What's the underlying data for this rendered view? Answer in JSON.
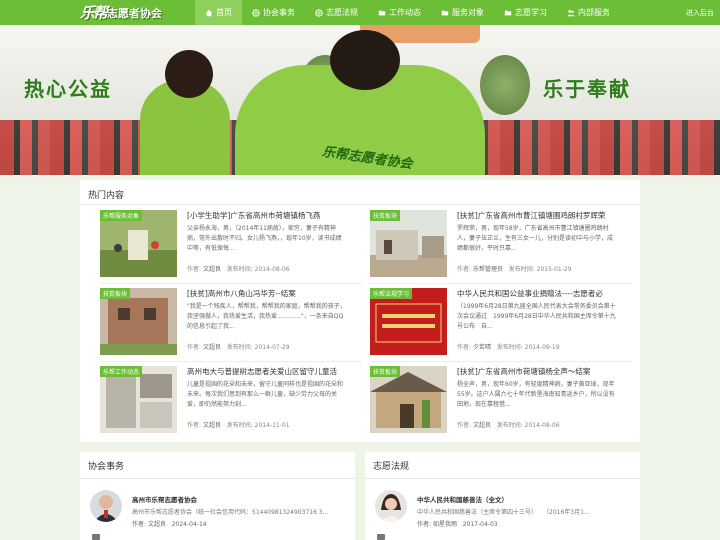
{
  "site": {
    "logo_big": "乐帮",
    "logo_small": "志愿者协会",
    "login": "进入后台"
  },
  "menu": [
    {
      "label": "首页",
      "icon": "home-icon",
      "active": true
    },
    {
      "label": "协会事务",
      "icon": "globe-icon"
    },
    {
      "label": "志愿法规",
      "icon": "globe-icon"
    },
    {
      "label": "工作动态",
      "icon": "folder-icon"
    },
    {
      "label": "服务对象",
      "icon": "folder-icon"
    },
    {
      "label": "志愿学习",
      "icon": "folder-icon"
    },
    {
      "label": "内部服务",
      "icon": "users-icon"
    }
  ],
  "banner": {
    "slogan_left": "热心公益",
    "slogan_right": "乐于奉献",
    "jacket_text": "乐帮志愿者协会"
  },
  "hot": {
    "title": "热门内容",
    "items": [
      {
        "tag": "乐帮服务对象",
        "title": "[小学生助学]广东省高州市荷塘镇杨飞燕",
        "desc": "父亲杨永海，男，（2014年11病故），家穷，妻子有精神病，常外出散时不归。女儿杨飞燕，，现年10岁，读书成绩中等，有低保每...",
        "author_label": "作者:",
        "author": "文超良",
        "date_label": "发布时间:",
        "date": "2014-08-06"
      },
      {
        "tag": "扶贫板块",
        "title": "[扶贫]广东省高州市曹江镇塘圃鸡朗村罗辉荣",
        "desc": "罗辉荣，男，现年58岁，广东省高州市曹江镇塘圃鸡朗村人，妻子伍正兰，生有三女一儿，分别是读初中与小学，成绩都很好，平时只靠...",
        "author_label": "作者:",
        "author": "乐帮管理员",
        "date_label": "发布时间:",
        "date": "2015-01-29"
      },
      {
        "tag": "扶贫板块",
        "title": "[扶贫]高州市八角山冯华芳--结案",
        "desc": "\"我是一个残疾人，帮帮我，帮帮我的家庭，帮帮我的孩子，我坚强做人，我热爱生活，我热爱…………\"，一条来自QQ的信息引起了我...",
        "author_label": "作者:",
        "author": "文超良",
        "date_label": "发布时间:",
        "date": "2014-07-29"
      },
      {
        "tag": "乐帮法规学习",
        "title": "中华人民共和国公益事业捐赠法----志愿者必",
        "desc": "（1999年6月28日第九届全国人民代表大会常务委员会第十次会议通过　1999年6月28日中华人民共和国主席令第十九号公布　自...",
        "author_label": "作者:",
        "author": "夕若晴",
        "date_label": "发布时间:",
        "date": "2014-09-19"
      },
      {
        "tag": "乐帮工作动态",
        "title": "高州电大与普提树志愿者关爱山区留守儿童活",
        "desc": "儿童是祖国的花朵和未来，留守儿童同样也是祖国的花朵和未来。每次我们思到有那么一群儿童，缺少劳力父母的关爱，即仍然能努力刻...",
        "author_label": "作者:",
        "author": "文超良",
        "date_label": "发布时间:",
        "date": "2014-11-01"
      },
      {
        "tag": "扶贫板块",
        "title": "[扶贫]广东省高州市荷塘镇杨全声～结案",
        "desc": "杨全声，男，现年60岁，有轻度精神病，妻子黄亚球，现年55岁。这户人属六七十年代新垦海南知青返乡户，所以没有田地，现在靠租借...",
        "author_label": "作者:",
        "author": "文超良",
        "date_label": "发布时间:",
        "date": "2014-08-06"
      }
    ]
  },
  "affairs": {
    "title": "协会事务",
    "item": {
      "name": "高州市乐帮志愿者协会",
      "desc": "高州市乐帮志愿者协会（统一社会信用代码：51440981324903716 3...",
      "author_label": "作者:",
      "author": "文超良",
      "date": "2024-04-14"
    }
  },
  "laws": {
    "title": "志愿法规",
    "item": {
      "name": "中华人民共和国慈善法（全文）",
      "desc": "中华人民共和国慈善法（主席令第四十三号）　　（2016年3月1...",
      "author_label": "作者:",
      "author": "如星我雨",
      "date": "2017-04-03"
    }
  },
  "colors": {
    "brand_green": "#6cbe36",
    "active_tab": "#8fd05c",
    "slogan": "#2e7d1b"
  }
}
